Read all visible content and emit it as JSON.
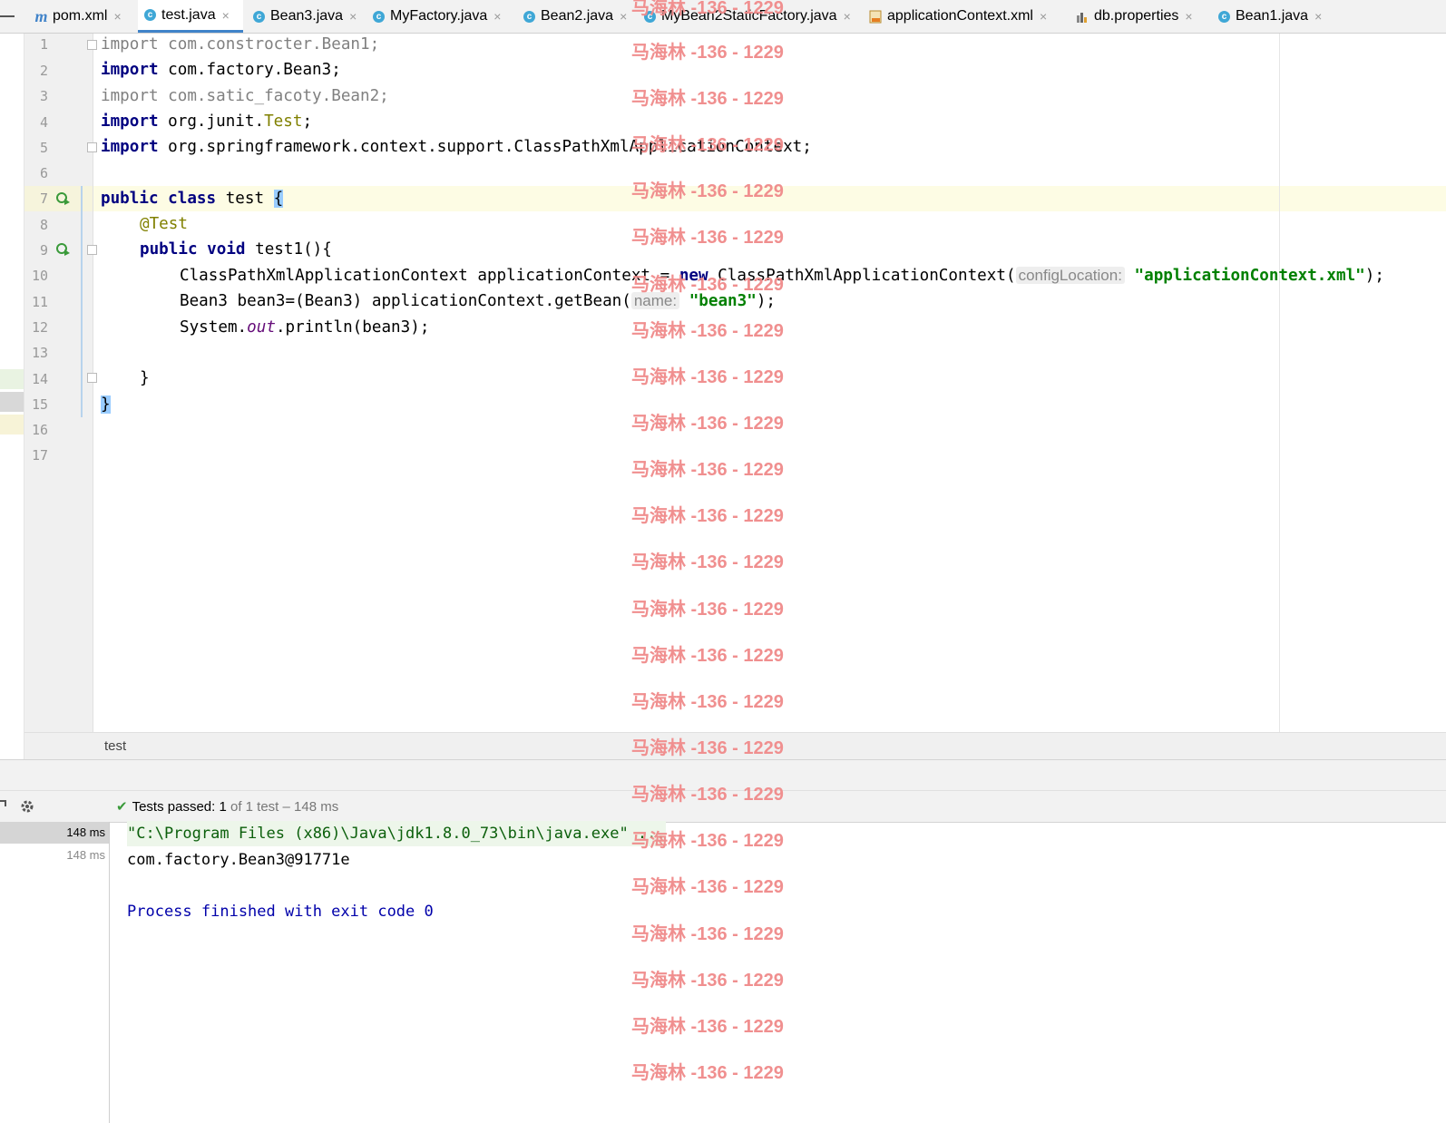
{
  "tabs": [
    {
      "label": "pom.xml",
      "icon": "maven-icon",
      "active": false
    },
    {
      "label": "test.java",
      "icon": "java-test-class-icon",
      "active": true
    },
    {
      "label": "Bean3.java",
      "icon": "java-class-icon",
      "active": false
    },
    {
      "label": "MyFactory.java",
      "icon": "java-class-icon",
      "active": false
    },
    {
      "label": "Bean2.java",
      "icon": "java-class-icon",
      "active": false
    },
    {
      "label": "MyBean2StaticFactory.java",
      "icon": "java-class-icon",
      "active": false
    },
    {
      "label": "applicationContext.xml",
      "icon": "xml-file-icon",
      "active": false
    },
    {
      "label": "db.properties",
      "icon": "properties-file-icon",
      "active": false
    },
    {
      "label": "Bean1.java",
      "icon": "java-class-icon",
      "active": false
    }
  ],
  "close_glyph": "×",
  "editor": {
    "line_numbers": [
      "1",
      "2",
      "3",
      "4",
      "5",
      "6",
      "7",
      "8",
      "9",
      "10",
      "11",
      "12",
      "13",
      "14",
      "15",
      "16",
      "17"
    ],
    "lines": {
      "l1": {
        "kw": "import",
        "rest": " com.constrocter.Bean1;"
      },
      "l2": {
        "kw": "import",
        "rest": " com.factory.Bean3;"
      },
      "l3": {
        "kw": "import",
        "rest": " com.satic_facoty.Bean2;"
      },
      "l4": {
        "kw": "import",
        "pkg": " org.junit.",
        "cls": "Test",
        "end": ";"
      },
      "l5": {
        "kw": "import",
        "rest": " org.springframework.context.support.ClassPathXmlApplicationContext;"
      },
      "l7": {
        "kw": "public class",
        "name": " test ",
        "brace": "{"
      },
      "l8": {
        "ann": "@Test"
      },
      "l9": {
        "kw": "public void",
        "rest": " test1(){"
      },
      "l10": {
        "a": "ClassPathXmlApplicationContext applicationContext = ",
        "kw": "new",
        "b": " ClassPathXmlApplicationContext(",
        "hint": "configLocation:",
        "str": "\"applicationContext.xml\"",
        "end": ");"
      },
      "l11": {
        "a": "Bean3 bean3=(Bean3) applicationContext.getBean(",
        "hint": "name:",
        "str": "\"bean3\"",
        "end": ");"
      },
      "l12": {
        "a": "System.",
        "fld": "out",
        "b": ".println(bean3);"
      },
      "l14": {
        "rest": "}"
      },
      "l15": {
        "brace": "}"
      }
    }
  },
  "breadcrumb": "test",
  "run": {
    "status_label": "Tests passed:",
    "status_count": "1",
    "status_rest": "of 1 test – 148 ms",
    "tree": [
      "148 ms",
      "148 ms"
    ],
    "output": {
      "cmd": "\"C:\\Program Files (x86)\\Java\\jdk1.8.0_73\\bin\\java.exe\" ...",
      "result": "com.factory.Bean3@91771e",
      "exit": "Process finished with exit code 0"
    }
  },
  "watermark": "马海林 -136 - 1229"
}
